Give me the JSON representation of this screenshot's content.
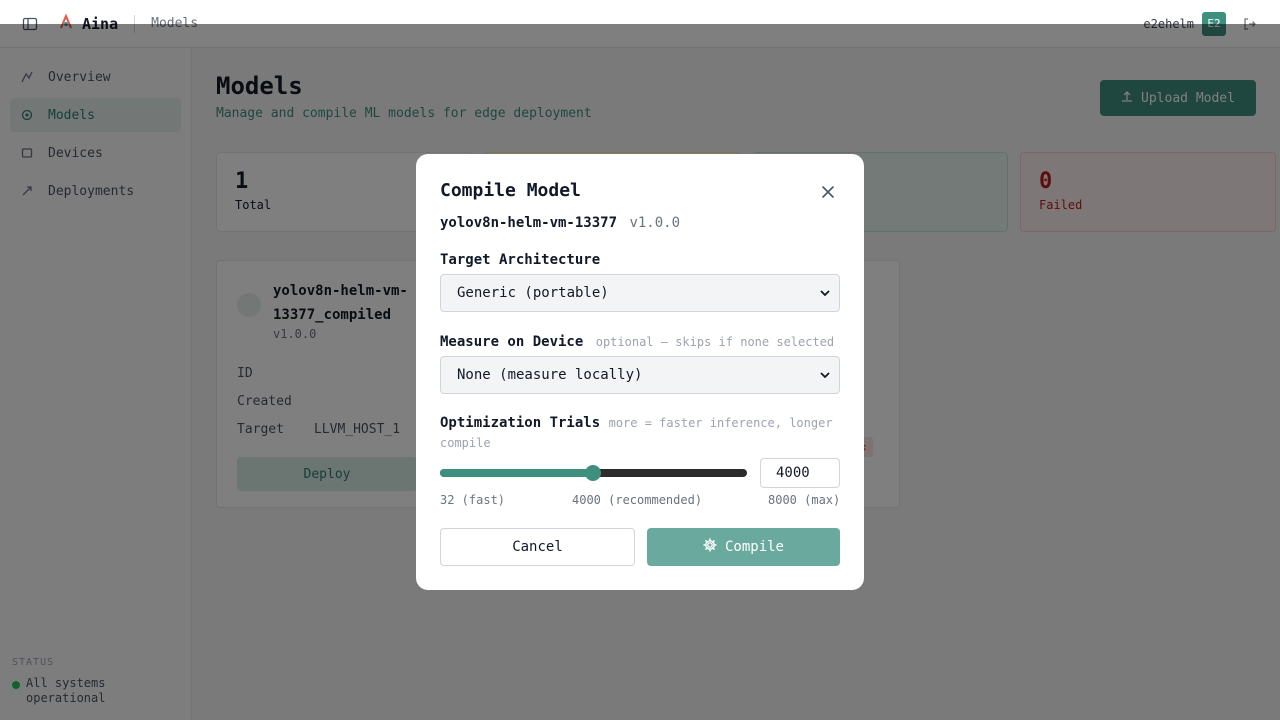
{
  "topbar": {
    "app_name": "Aina",
    "breadcrumb": "Models",
    "username": "e2ehelm",
    "avatar_initials": "E2",
    "icons": {
      "sidebar_toggle": "sidebar-toggle-icon",
      "logo": "aina-logo-icon",
      "logout": "logout-icon"
    }
  },
  "sidebar": {
    "items": [
      {
        "label": "Overview",
        "icon": "overview-icon",
        "active": false
      },
      {
        "label": "Models",
        "icon": "models-icon",
        "active": true
      },
      {
        "label": "Devices",
        "icon": "devices-icon",
        "active": false
      },
      {
        "label": "Deployments",
        "icon": "deployments-icon",
        "active": false
      }
    ],
    "status": {
      "title": "STATUS",
      "text": "All systems operational"
    }
  },
  "main": {
    "title": "Models",
    "subtitle": "Manage and compile ML models for edge deployment",
    "upload_button": "Upload Model",
    "stats": [
      {
        "value": "1",
        "label": "Total"
      },
      {
        "value": "",
        "label": ""
      },
      {
        "value": "",
        "label": ""
      },
      {
        "value": "0",
        "label": "Failed"
      }
    ],
    "model_card": {
      "name": "yolov8n-helm-vm-13377_compiled",
      "version": "v1.0.0",
      "rows": [
        {
          "key": "ID",
          "value": ""
        },
        {
          "key": "Created",
          "value": ""
        },
        {
          "key": "Target",
          "value": "LLVM_HOST_1"
        }
      ],
      "deploy_label": "Deploy"
    }
  },
  "modal": {
    "title": "Compile Model",
    "model_name": "yolov8n-helm-vm-13377",
    "model_version": "v1.0.0",
    "target_arch": {
      "label": "Target Architecture",
      "selected": "Generic (portable)"
    },
    "measure_device": {
      "label": "Measure on Device",
      "hint": "optional — skips if none selected",
      "selected": "None (measure locally)"
    },
    "trials": {
      "label": "Optimization Trials",
      "hint": "more = faster inference, longer compile",
      "value": "4000",
      "min": 32,
      "max": 8000,
      "current": 4000,
      "min_label": "32 (fast)",
      "mid_label": "4000 (recommended)",
      "max_label": "8000 (max)"
    },
    "cancel_label": "Cancel",
    "compile_label": "Compile",
    "accent_color": "#3f8f7f"
  }
}
